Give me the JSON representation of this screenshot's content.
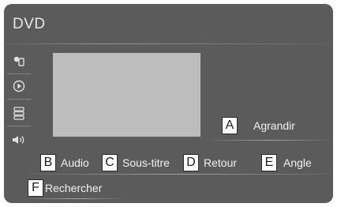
{
  "screen": {
    "title": "DVD"
  },
  "sidebar": {
    "items": [
      {
        "icon": "source-icon"
      },
      {
        "icon": "play-icon"
      },
      {
        "icon": "menu-list-icon"
      },
      {
        "icon": "speaker-icon"
      }
    ]
  },
  "buttons": {
    "agrandir": {
      "callout": "A",
      "label": "Agrandir"
    },
    "audio": {
      "callout": "B",
      "label": "Audio"
    },
    "sous_titre": {
      "callout": "C",
      "label": "Sous-titre"
    },
    "retour": {
      "callout": "D",
      "label": "Retour"
    },
    "angle": {
      "callout": "E",
      "label": "Angle"
    },
    "rechercher": {
      "callout": "F",
      "label": "Rechercher"
    }
  },
  "colors": {
    "screen_bg": "#5b5b5b",
    "video_placeholder": "#bdbdbd",
    "text": "#f2f2f2",
    "callout_bg": "#ffffff"
  }
}
